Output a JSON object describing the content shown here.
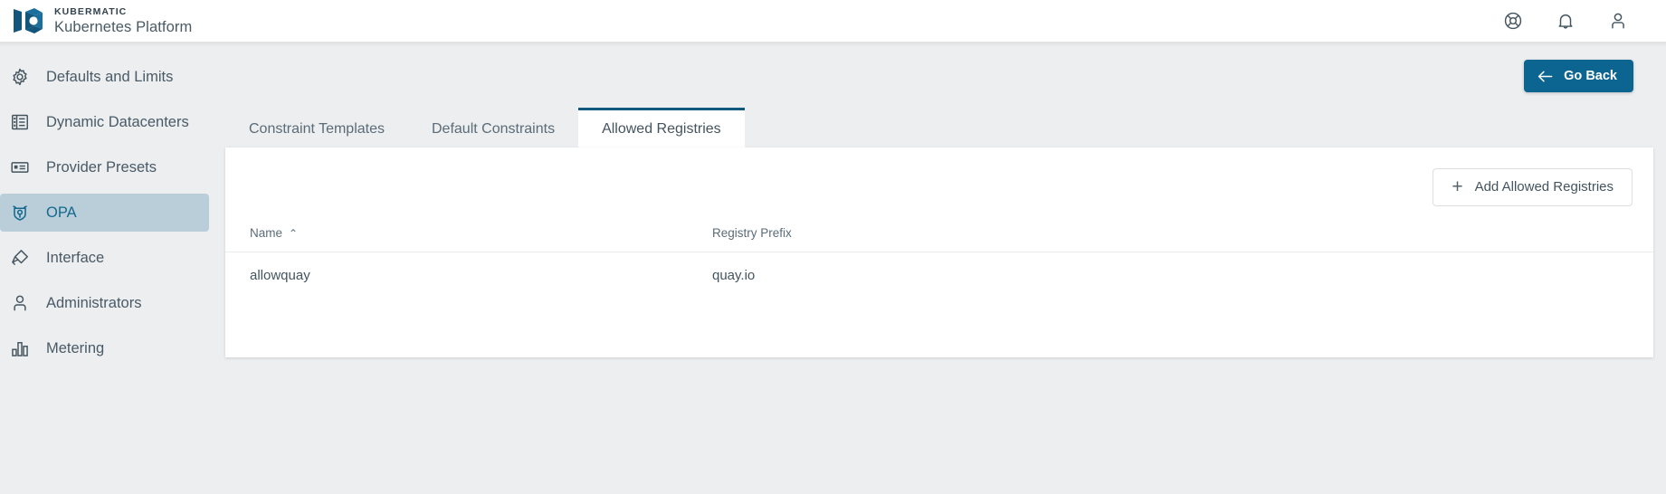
{
  "header": {
    "logo_title": "KUBERMATIC",
    "logo_subtitle": "Kubernetes Platform",
    "icons": [
      {
        "name": "help-icon",
        "label": "Help"
      },
      {
        "name": "notifications-icon",
        "label": "Notifications"
      },
      {
        "name": "account-icon",
        "label": "Account"
      }
    ]
  },
  "sidebar": {
    "items": [
      {
        "label": "Defaults and Limits",
        "icon": "gear-icon",
        "active": false
      },
      {
        "label": "Dynamic Datacenters",
        "icon": "datacenter-icon",
        "active": false
      },
      {
        "label": "Provider Presets",
        "icon": "card-icon",
        "active": false
      },
      {
        "label": "OPA",
        "icon": "opa-shield-icon",
        "active": true
      },
      {
        "label": "Interface",
        "icon": "interface-icon",
        "active": false
      },
      {
        "label": "Administrators",
        "icon": "person-icon",
        "active": false
      },
      {
        "label": "Metering",
        "icon": "bar-chart-icon",
        "active": false
      }
    ]
  },
  "main": {
    "go_back_label": "Go Back",
    "tabs": [
      {
        "label": "Constraint Templates",
        "active": false
      },
      {
        "label": "Default Constraints",
        "active": false
      },
      {
        "label": "Allowed Registries",
        "active": true
      }
    ],
    "add_button_label": "Add Allowed Registries",
    "table": {
      "columns": [
        {
          "label": "Name",
          "sort": "asc",
          "sort_glyph": "⌃"
        },
        {
          "label": "Registry Prefix",
          "sort": "none",
          "sort_glyph": ""
        }
      ],
      "rows": [
        {
          "name": "allowquay",
          "registry_prefix": "quay.io"
        }
      ]
    }
  },
  "colors": {
    "accent": "#0c6490",
    "active_tab_border": "#10597d",
    "sidebar_active_bg": "#b9ced8",
    "sidebar_active_text": "#15688f",
    "page_bg": "#eceef0",
    "text": "#44545f"
  }
}
